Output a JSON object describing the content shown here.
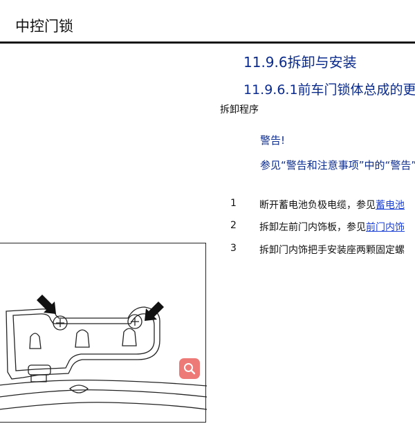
{
  "header": {
    "title": "中控门锁"
  },
  "section": {
    "heading": "11.9.6拆卸与安装",
    "subheading": "11.9.6.1前车门锁体总成的更"
  },
  "procedure_label": "拆卸程序",
  "warning": {
    "title": "警告!",
    "text": "参见“警告和注意事项”中的“警告”。"
  },
  "steps": [
    {
      "num": "1",
      "text": "断开蓄电池负极电缆，参见",
      "link": "蓄电池"
    },
    {
      "num": "2",
      "text": "拆卸左前门内饰板，参见",
      "link": "前门内饰"
    },
    {
      "num": "3",
      "text": "拆卸门内饰把手安装座两颗固定螺",
      "link": ""
    }
  ],
  "icons": {
    "zoom": "magnifier-icon",
    "arrows": "arrow-icon"
  },
  "colors": {
    "heading": "#0a2a8c",
    "link": "#1a3fd6",
    "zoom_button": "#ee7a78"
  }
}
